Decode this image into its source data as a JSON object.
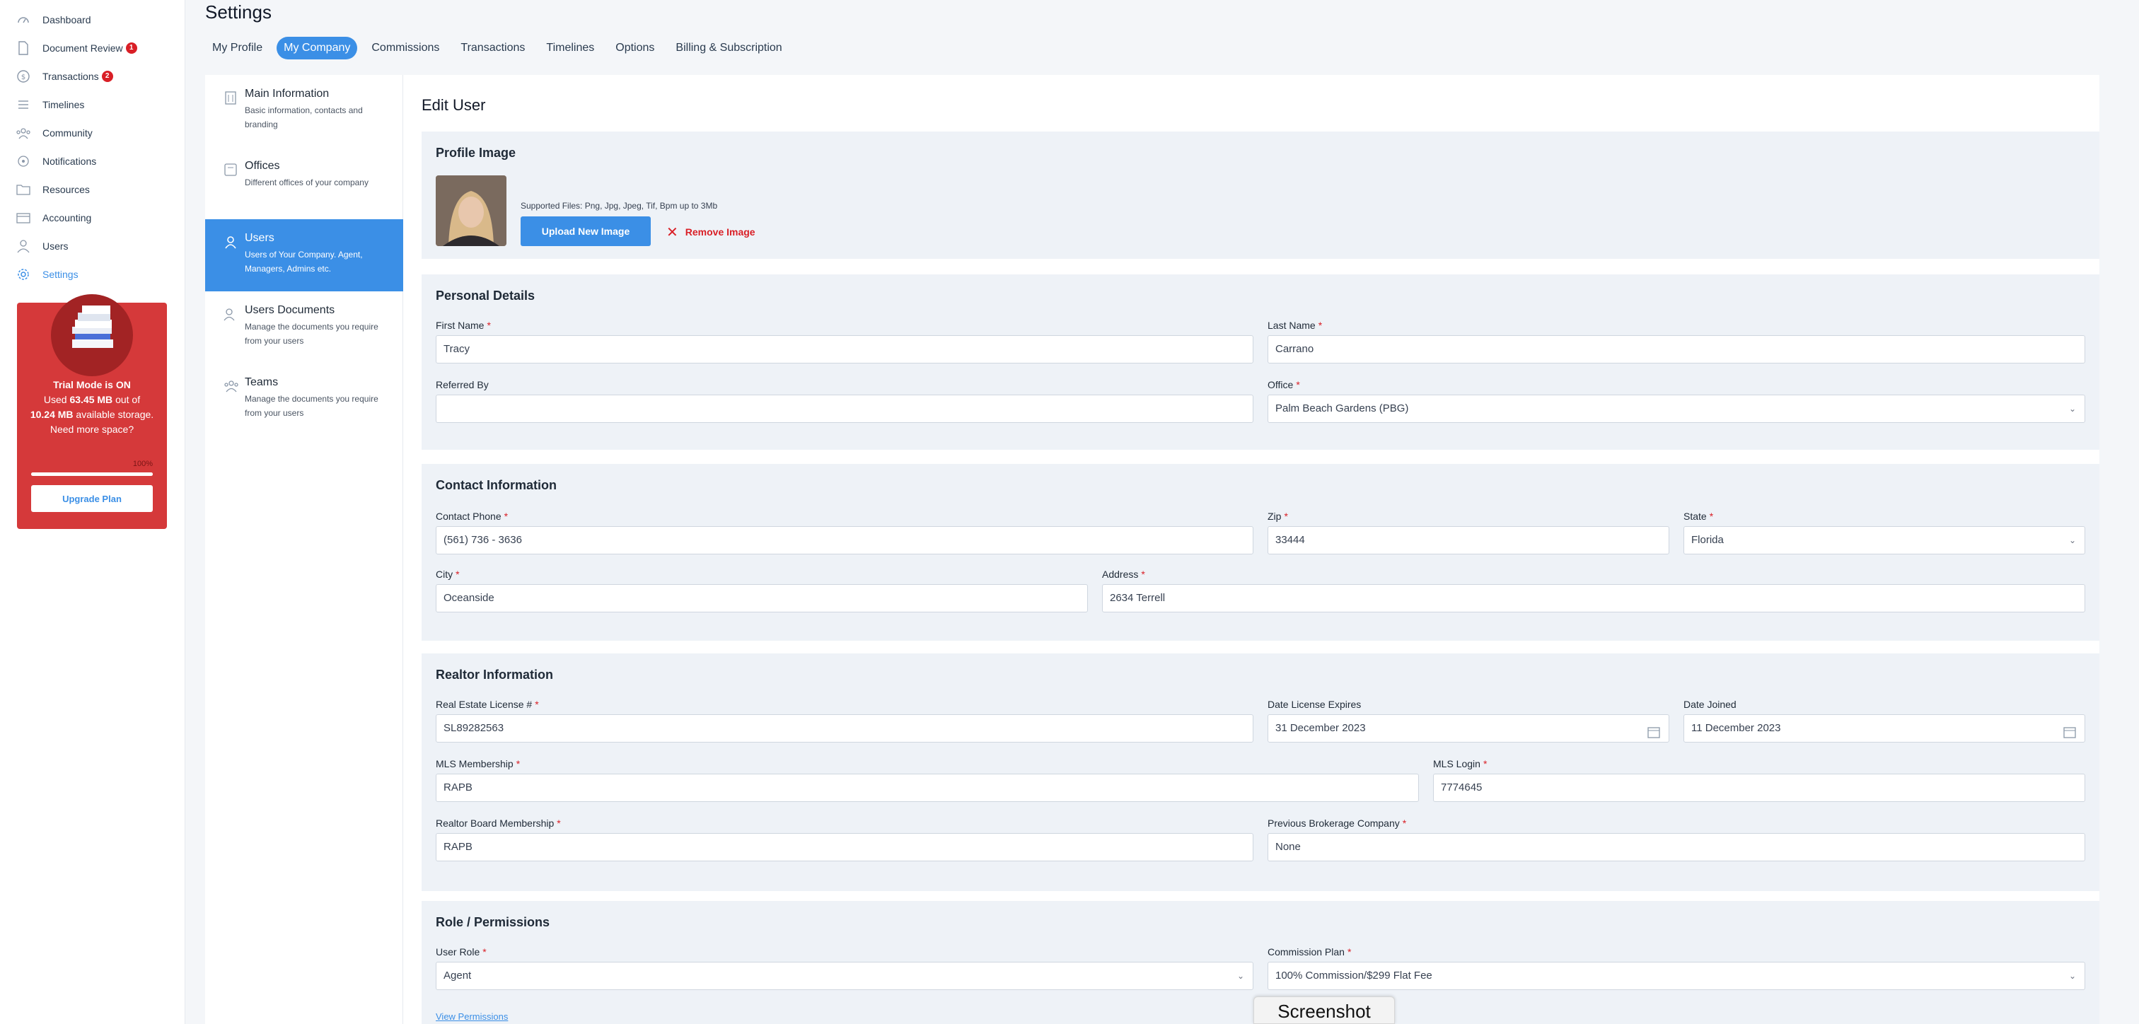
{
  "sidebar": {
    "items": [
      {
        "label": "Dashboard",
        "icon": "dashboard-icon"
      },
      {
        "label": "Document Review",
        "icon": "document-icon",
        "badge": "1"
      },
      {
        "label": "Transactions",
        "icon": "transactions-icon",
        "badge": "2"
      },
      {
        "label": "Timelines",
        "icon": "timeline-icon"
      },
      {
        "label": "Community",
        "icon": "community-icon"
      },
      {
        "label": "Notifications",
        "icon": "bell-icon"
      },
      {
        "label": "Resources",
        "icon": "folder-icon"
      },
      {
        "label": "Accounting",
        "icon": "accounting-icon"
      },
      {
        "label": "Users",
        "icon": "user-icon"
      },
      {
        "label": "Settings",
        "icon": "gear-icon"
      }
    ],
    "trial": {
      "line1": "Trial Mode is ON",
      "used_prefix": "Used",
      "used_value": "63.45 MB",
      "used_mid": "out of",
      "total_value": "10.24 MB",
      "total_suffix": "available storage.",
      "need_more": "Need more space?",
      "percent_label": "100%",
      "percent": 100,
      "upgrade_label": "Upgrade Plan"
    }
  },
  "header": {
    "title": "Settings",
    "tabs": [
      "My Profile",
      "My Company",
      "Commissions",
      "Transactions",
      "Timelines",
      "Options",
      "Billing & Subscription"
    ]
  },
  "subnav": [
    {
      "title": "Main Information",
      "desc": "Basic information, contacts and branding"
    },
    {
      "title": "Offices",
      "desc": "Different offices of your company"
    },
    {
      "title": "Users",
      "desc": "Users of Your Company. Agent, Managers, Admins etc."
    },
    {
      "title": "Users Documents",
      "desc": "Manage the documents you require from your users"
    },
    {
      "title": "Teams",
      "desc": "Manage the documents you require from your users"
    }
  ],
  "content": {
    "title": "Edit User",
    "profile": {
      "title": "Profile Image",
      "supported": "Supported Files: Png, Jpg, Jpeg, Tif, Bpm up to 3Mb",
      "upload_label": "Upload New Image",
      "remove_label": "Remove Image"
    },
    "personal": {
      "title": "Personal Details",
      "first_name_label": "First Name",
      "first_name": "Tracy",
      "last_name_label": "Last Name",
      "last_name": "Carrano",
      "referred_label": "Referred By",
      "referred": "",
      "office_label": "Office",
      "office": "Palm Beach Gardens (PBG)"
    },
    "contact": {
      "title": "Contact Information",
      "phone_label": "Contact Phone",
      "phone": "(561) 736 - 3636",
      "zip_label": "Zip",
      "zip": "33444",
      "state_label": "State",
      "state": "Florida",
      "city_label": "City",
      "city": "Oceanside",
      "address_label": "Address",
      "address": "2634 Terrell"
    },
    "realtor": {
      "title": "Realtor Information",
      "license_label": "Real Estate License #",
      "license": "SL89282563",
      "expires_label": "Date License Expires",
      "expires": "31 December 2023",
      "joined_label": "Date Joined",
      "joined": "11 December 2023",
      "mls_label": "MLS Membership",
      "mls": "RAPB",
      "mls_login_label": "MLS Login",
      "mls_login": "7774645",
      "board_label": "Realtor Board Membership",
      "board": "RAPB",
      "prev_label": "Previous Brokerage Company",
      "prev": "None"
    },
    "role": {
      "title": "Role / Permissions",
      "role_label": "User Role",
      "role": "Agent",
      "plan_label": "Commission Plan",
      "plan": "100% Commission/$299 Flat Fee",
      "view_permissions": "View Permissions"
    }
  },
  "tooltip": "Screenshot",
  "colors": {
    "accent": "#3b8fe6",
    "danger": "#d91f26",
    "trial_bg": "#d5393a",
    "section_bg": "#eef2f7"
  }
}
